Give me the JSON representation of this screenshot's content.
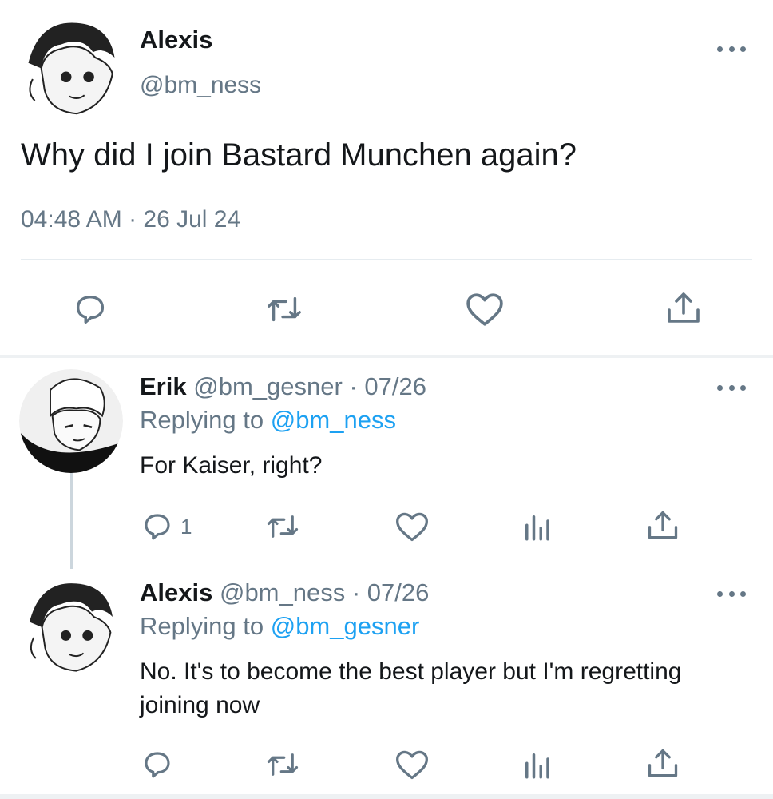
{
  "main_tweet": {
    "author_name": "Alexis",
    "author_handle": "@bm_ness",
    "text": "Why did I join Bastard Munchen again?",
    "timestamp": "04:48 AM · 26 Jul 24",
    "actions": [
      "reply-icon",
      "retweet-icon",
      "like-icon",
      "share-icon"
    ]
  },
  "replies": [
    {
      "author_name": "Erik",
      "author_handle": "@bm_gesner",
      "date": "· 07/26",
      "replying_prefix": "Replying to",
      "replying_to": "@bm_ness",
      "text": "For Kaiser, right?",
      "reply_count": "1",
      "actions": [
        "reply-icon",
        "retweet-icon",
        "like-icon",
        "analytics-icon",
        "share-icon"
      ]
    },
    {
      "author_name": "Alexis",
      "author_handle": "@bm_ness",
      "date": "· 07/26",
      "replying_prefix": "Replying to",
      "replying_to": "@bm_gesner",
      "text": "No. It's to become the best player but I'm regretting joining now",
      "reply_count": "",
      "actions": [
        "reply-icon",
        "retweet-icon",
        "like-icon",
        "analytics-icon",
        "share-icon"
      ]
    }
  ],
  "colors": {
    "text": "#14171a",
    "secondary": "#657786",
    "link": "#1da1f2",
    "divider": "#e6ecf0"
  }
}
